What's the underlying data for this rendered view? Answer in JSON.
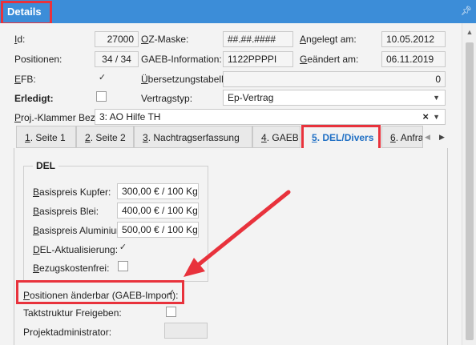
{
  "header": {
    "title": "Details",
    "pin_icon": "pin-icon"
  },
  "fields": {
    "id": {
      "label": "Id:",
      "value": "27000"
    },
    "oz_maske": {
      "label": "OZ-Maske:",
      "value": "##.##.####"
    },
    "angelegt": {
      "label": "Angelegt am:",
      "value": "10.05.2012"
    },
    "positionen": {
      "label": "Positionen:",
      "value": "34 / 34"
    },
    "gaeb_info": {
      "label": "GAEB-Information:",
      "value": "1122PPPPI"
    },
    "geaendert": {
      "label": "Geändert am:",
      "value": "06.11.2019"
    },
    "efb": {
      "label": "EFB:",
      "checked": true
    },
    "uebersetzung": {
      "label": "Übersetzungstabelle",
      "value": "0"
    },
    "erledigt": {
      "label": "Erledigt:",
      "checked": false
    },
    "vertragstyp": {
      "label": "Vertragstyp:",
      "value": "Ep-Vertrag"
    },
    "klammer": {
      "label": "Proj.-Klammer Bez:",
      "value": "3: AO Hilfe TH",
      "clear_icon": "×"
    }
  },
  "tabs": [
    {
      "label": "1. Seite 1"
    },
    {
      "label": "2. Seite 2"
    },
    {
      "label": "3. Nachtragserfassung"
    },
    {
      "label": "4. GAEB"
    },
    {
      "label": "5. DEL/Divers",
      "active": true
    },
    {
      "label": "6. Anfra"
    }
  ],
  "del_group": {
    "title": "DEL",
    "kupfer": {
      "label": "Basispreis Kupfer:",
      "value": "300,00 € / 100 Kg"
    },
    "blei": {
      "label": "Basispreis Blei:",
      "value": "400,00 € / 100 Kg"
    },
    "aluminium": {
      "label": "Basispreis Aluminium:",
      "value": "500,00 € / 100 Kg"
    },
    "aktualisierung": {
      "label": "DEL-Aktualisierung:",
      "checked": true
    },
    "bezugskosten": {
      "label": "Bezugskostenfrei:",
      "checked": false
    }
  },
  "extra": {
    "positionen_aenderbar": {
      "label": "Positionen änderbar (GAEB-Import):",
      "checked": true
    },
    "taktstruktur": {
      "label": "Taktstruktur Freigeben:",
      "checked": false
    },
    "projektadmin": {
      "label": "Projektadministrator:",
      "value": ""
    }
  },
  "colors": {
    "accent": "#3c8dd8",
    "highlight": "#e8323c",
    "active_tab_text": "#1f6fc4"
  }
}
